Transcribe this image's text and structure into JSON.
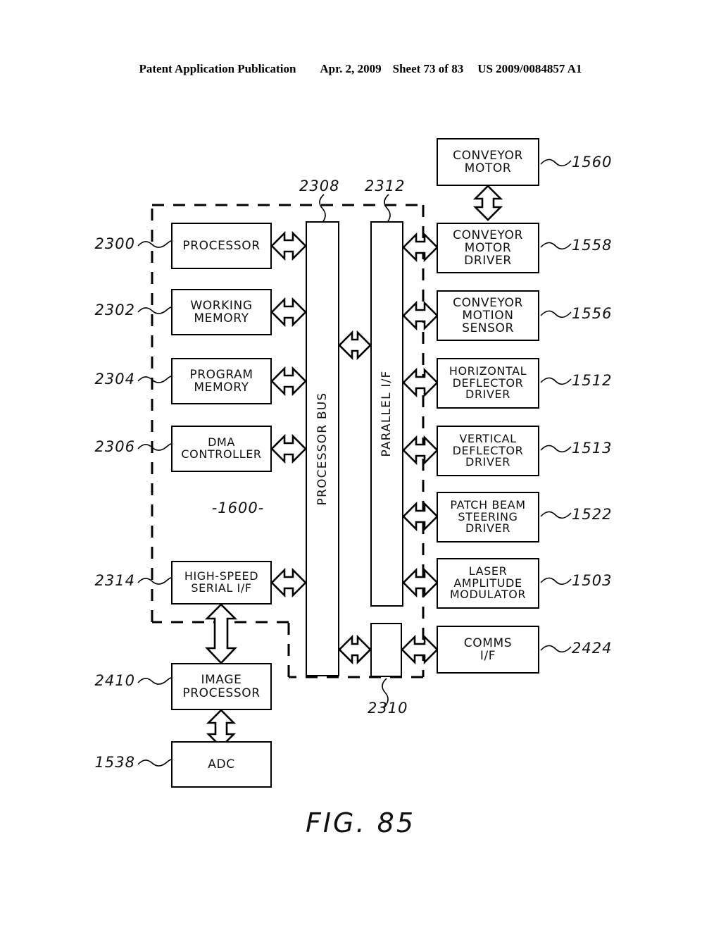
{
  "header": {
    "publication": "Patent Application Publication",
    "date": "Apr. 2, 2009",
    "sheet": "Sheet 73 of 83",
    "patent_number": "US 2009/0084857 A1"
  },
  "figure": {
    "caption": "FIG. 85",
    "enclosure_label": "-1600-"
  },
  "left_blocks": [
    {
      "label_line1": "PROCESSOR",
      "label_line2": "",
      "label_line3": "",
      "ref": "2300"
    },
    {
      "label_line1": "WORKING",
      "label_line2": "MEMORY",
      "label_line3": "",
      "ref": "2302"
    },
    {
      "label_line1": "PROGRAM",
      "label_line2": "MEMORY",
      "label_line3": "",
      "ref": "2304"
    },
    {
      "label_line1": "DMA",
      "label_line2": "CONTROLLER",
      "label_line3": "",
      "ref": "2306"
    },
    {
      "label_line1": "HIGH-SPEED",
      "label_line2": "SERIAL I/F",
      "label_line3": "",
      "ref": "2314"
    },
    {
      "label_line1": "IMAGE",
      "label_line2": "PROCESSOR",
      "label_line3": "",
      "ref": "2410"
    },
    {
      "label_line1": "ADC",
      "label_line2": "",
      "label_line3": "",
      "ref": "1538"
    }
  ],
  "bus_blocks": [
    {
      "label": "PROCESSOR BUS",
      "ref": "2308"
    },
    {
      "label": "PARALLEL I/F",
      "ref": "2312"
    },
    {
      "label": "",
      "ref": "2310"
    }
  ],
  "right_blocks": [
    {
      "label_line1": "CONVEYOR",
      "label_line2": "MOTOR",
      "label_line3": "",
      "ref": "1560"
    },
    {
      "label_line1": "CONVEYOR",
      "label_line2": "MOTOR",
      "label_line3": "DRIVER",
      "ref": "1558"
    },
    {
      "label_line1": "CONVEYOR",
      "label_line2": "MOTION",
      "label_line3": "SENSOR",
      "ref": "1556"
    },
    {
      "label_line1": "HORIZONTAL",
      "label_line2": "DEFLECTOR",
      "label_line3": "DRIVER",
      "ref": "1512"
    },
    {
      "label_line1": "VERTICAL",
      "label_line2": "DEFLECTOR",
      "label_line3": "DRIVER",
      "ref": "1513"
    },
    {
      "label_line1": "PATCH BEAM",
      "label_line2": "STEERING",
      "label_line3": "DRIVER",
      "ref": "1522"
    },
    {
      "label_line1": "LASER",
      "label_line2": "AMPLITUDE",
      "label_line3": "MODULATOR",
      "ref": "1503"
    },
    {
      "label_line1": "COMMS",
      "label_line2": "I/F",
      "label_line3": "",
      "ref": "2424"
    }
  ],
  "colors": {
    "ink": "#000000",
    "paper": "#ffffff"
  }
}
